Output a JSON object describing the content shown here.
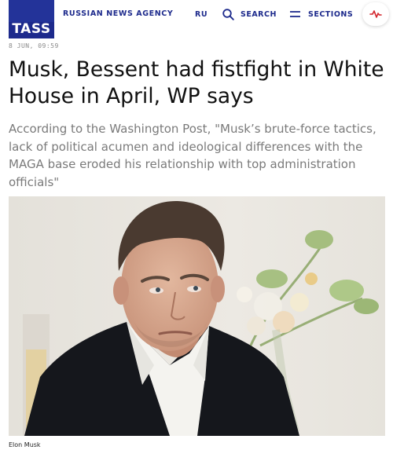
{
  "header": {
    "logo_text": "TASS",
    "agency_name": "RUSSIAN NEWS AGENCY",
    "language": "RU",
    "search_label": "SEARCH",
    "sections_label": "SECTIONS",
    "brand_color": "#1d2a8c",
    "icons": {
      "search": "search-icon",
      "sections": "menu-icon",
      "live": "pulse-icon"
    }
  },
  "article": {
    "timestamp": "8 JUN, 09:59",
    "headline": "Musk, Bessent had fistfight in White House in April, WP says",
    "subheadline": "According to the Washington Post, \"Musk’s brute-force tactics, lack of political acumen and ideological differences with the MAGA base eroded his relationship with top administration officials\"",
    "photo_caption": "Elon Musk"
  }
}
